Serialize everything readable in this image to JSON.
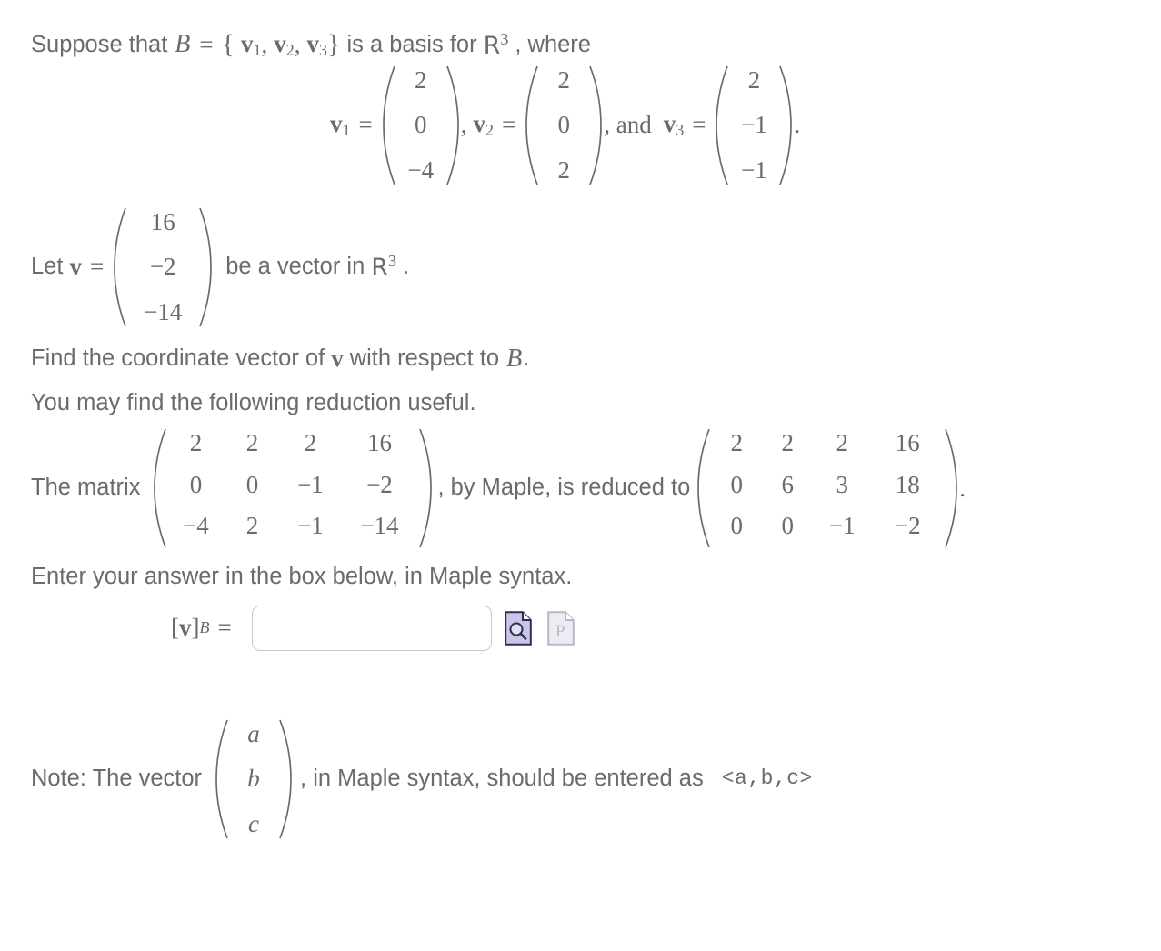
{
  "problem": {
    "intro": {
      "prefix": "Suppose that",
      "basis_symbol": "B",
      "equals": "=",
      "set_open": "{",
      "set_close": "}",
      "basis_vectors": [
        "v",
        "v",
        "v"
      ],
      "basis_subscripts": [
        "1",
        "2",
        "3"
      ],
      "comma": ",",
      "middle": "is a basis for",
      "space_symbol": "R",
      "space_exponent": "3",
      "suffix": ", where"
    },
    "basis_definitions": [
      {
        "name": "v",
        "subscript": "1",
        "equals": "=",
        "entries": [
          "2",
          "0",
          "−4"
        ],
        "trailing": ","
      },
      {
        "name": "v",
        "subscript": "2",
        "equals": "=",
        "entries": [
          "2",
          "0",
          "2"
        ],
        "trailing": ", and"
      },
      {
        "name": "v",
        "subscript": "3",
        "equals": "=",
        "entries": [
          "2",
          "−1",
          "−1"
        ],
        "trailing": "."
      }
    ],
    "let_v": {
      "prefix": "Let",
      "name": "v",
      "equals": "=",
      "entries": [
        "16",
        "−2",
        "−14"
      ],
      "suffix": "be a vector in",
      "space_symbol": "R",
      "space_exponent": "3",
      "period": "."
    },
    "find_line": {
      "part1": "Find the coordinate vector of",
      "vector": "v",
      "part2": "with respect to",
      "basis": "B",
      "period": "."
    },
    "useful_line": "You may find the following reduction useful.",
    "matrix_line": {
      "prefix": "The matrix",
      "original": [
        [
          "2",
          "2",
          "2",
          "16"
        ],
        [
          "0",
          "0",
          "−1",
          "−2"
        ],
        [
          "−4",
          "2",
          "−1",
          "−14"
        ]
      ],
      "middle": ", by Maple, is reduced to",
      "reduced": [
        [
          "2",
          "2",
          "2",
          "16"
        ],
        [
          "0",
          "6",
          "3",
          "18"
        ],
        [
          "0",
          "0",
          "−1",
          "−2"
        ]
      ],
      "period": "."
    },
    "enter_line": "Enter your answer in the box below, in Maple syntax.",
    "answer": {
      "label_open": "[",
      "label_vector": "v",
      "label_close": "]",
      "label_subscript": "B",
      "label_equals": "=",
      "value": "",
      "placeholder": "",
      "preview_icon": "document-magnifier-icon",
      "maple_icon": "document-p-icon"
    },
    "note": {
      "prefix": "Note: The vector",
      "entries": [
        "a",
        "b",
        "c"
      ],
      "middle": ", in Maple syntax, should be entered as",
      "syntax": "<a,b,c>"
    }
  },
  "colors": {
    "text": "#6b6b6b",
    "background": "#ffffff",
    "input_border": "#c9c9c9",
    "icon_active_fill": "#c9c6ea",
    "icon_active_border": "#2e2e4f",
    "icon_disabled_fill": "#ebebf2",
    "icon_disabled_border": "#b9b9c4"
  }
}
